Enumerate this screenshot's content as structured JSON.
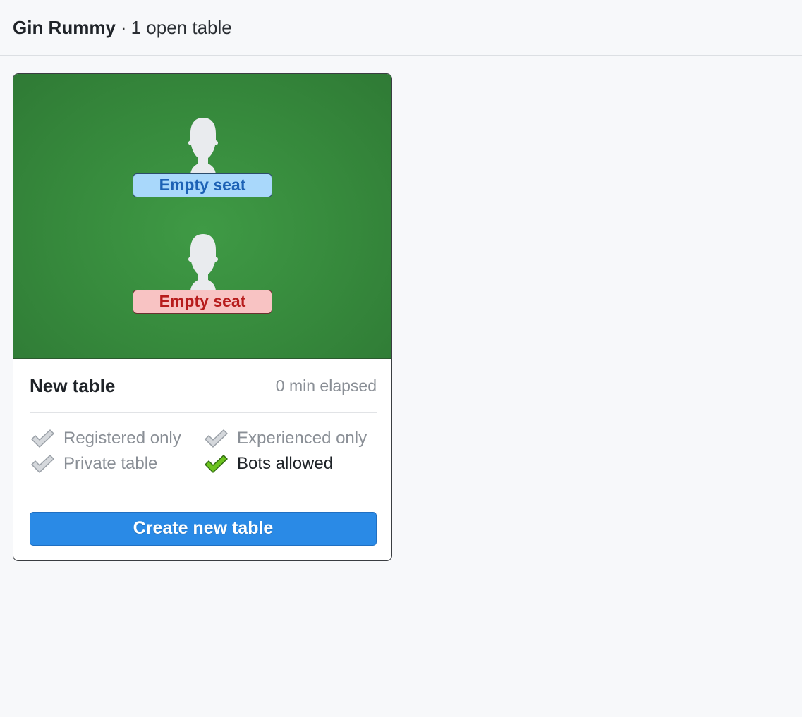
{
  "header": {
    "game_name": "Gin Rummy",
    "separator": "·",
    "open_tables": "1 open table"
  },
  "table_card": {
    "seats": [
      {
        "label": "Empty seat",
        "color": "#a9d8fb",
        "text_color": "#1d62b5",
        "icon": "person-silhouette-icon"
      },
      {
        "label": "Empty seat",
        "color": "#f8c3c3",
        "text_color": "#b71c1c",
        "icon": "person-silhouette-icon"
      }
    ],
    "felt_color": "#36893c",
    "name": "New table",
    "elapsed": "0 min elapsed",
    "options": [
      {
        "label": "Registered only",
        "enabled": false,
        "icon": "check-icon"
      },
      {
        "label": "Experienced only",
        "enabled": false,
        "icon": "check-icon"
      },
      {
        "label": "Private table",
        "enabled": false,
        "icon": "check-icon"
      },
      {
        "label": "Bots allowed",
        "enabled": true,
        "icon": "check-icon"
      }
    ],
    "create_button_label": "Create new table",
    "accent_color": "#2a8ae6"
  }
}
